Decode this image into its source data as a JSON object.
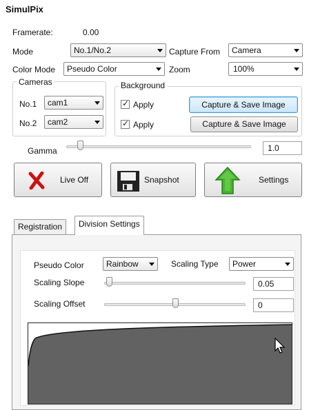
{
  "app": {
    "title": "SimulPix"
  },
  "framerate": {
    "label": "Framerate:",
    "value": "0.00"
  },
  "mode": {
    "label": "Mode",
    "value": "No.1/No.2"
  },
  "capture_from": {
    "label": "Capture From",
    "value": "Camera"
  },
  "color_mode": {
    "label": "Color Mode",
    "value": "Pseudo Color"
  },
  "zoom": {
    "label": "Zoom",
    "value": "100%"
  },
  "cameras": {
    "title": "Cameras",
    "items": [
      {
        "label": "No.1",
        "value": "cam1"
      },
      {
        "label": "No.2",
        "value": "cam2"
      }
    ]
  },
  "background": {
    "title": "Background",
    "rows": [
      {
        "apply_label": "Apply",
        "checked": true,
        "button_label": "Capture & Save Image"
      },
      {
        "apply_label": "Apply",
        "checked": true,
        "button_label": "Capture & Save Image"
      }
    ]
  },
  "gamma": {
    "label": "Gamma",
    "value": "1.0",
    "slider_fraction": 0.05
  },
  "actions": {
    "live": {
      "label": "Live Off",
      "icon": "red-x-icon"
    },
    "snapshot": {
      "label": "Snapshot",
      "icon": "floppy-disk-icon"
    },
    "settings": {
      "label": "Settings",
      "icon": "green-up-arrow-icon"
    }
  },
  "tabs": [
    {
      "label": "Registration",
      "active": false
    },
    {
      "label": "Division Settings",
      "active": true
    }
  ],
  "division": {
    "pseudo_color": {
      "label": "Pseudo Color",
      "value": "Rainbow"
    },
    "scaling_type": {
      "label": "Scaling Type",
      "value": "Power"
    },
    "scaling_slope": {
      "label": "Scaling Slope",
      "value": "0.05",
      "slider_fraction": 0.05
    },
    "scaling_offset": {
      "label": "Scaling Offset",
      "value": "0",
      "slider_fraction": 0.5
    }
  },
  "colors": {
    "focus_blue": "#3c9ad8",
    "plot_fill": "#626262",
    "live_icon": "#cc1111",
    "settings_icon": "#3fae2a"
  }
}
